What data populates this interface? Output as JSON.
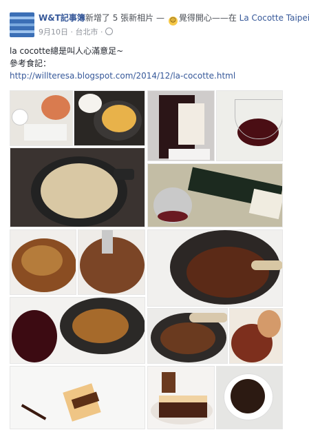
{
  "header": {
    "author": "W&T記事簿",
    "action_text": "新增了 5 張新相片 —",
    "feeling_icon": "smiley-icon",
    "feeling_text": "覺得開心——在",
    "place": "La Cocotte Taipei"
  },
  "meta": {
    "date": "9月10日",
    "location": "台北市",
    "privacy_icon": "globe-icon"
  },
  "post": {
    "line1": "la cocotte總是叫人心滿意足~",
    "line2": "參考食記：",
    "link": "http://willteresa.blogspot.com/2014/12/la-cocotte.html"
  },
  "photos": [
    {
      "name": "photo-bread-butter"
    },
    {
      "name": "photo-cocotte-gratin"
    },
    {
      "name": "photo-wine-bottle-label"
    },
    {
      "name": "photo-red-wine-glass"
    },
    {
      "name": "photo-cocotte-rice"
    },
    {
      "name": "photo-pouring-wine"
    },
    {
      "name": "photo-chicken-dish"
    },
    {
      "name": "photo-chicken-fork"
    },
    {
      "name": "photo-braised-short-rib"
    },
    {
      "name": "photo-wine-and-cocotte"
    },
    {
      "name": "photo-bone-marrow-dish"
    },
    {
      "name": "photo-dish-closeup"
    },
    {
      "name": "photo-mousse-cake"
    },
    {
      "name": "photo-chocolate-cake"
    },
    {
      "name": "photo-coffee-cup"
    }
  ]
}
